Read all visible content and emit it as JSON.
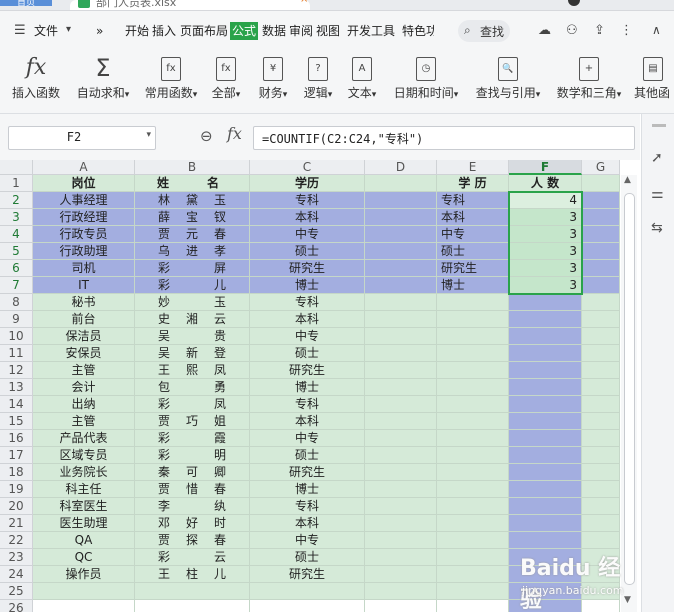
{
  "titlebar": {
    "home_tab": "首页",
    "doc_tab": "部门人员表.xlsx",
    "close": "×"
  },
  "menubar": {
    "file_menu": "文件",
    "more": "»",
    "tabs": [
      "开始",
      "插入",
      "页面布局",
      "公式",
      "数据",
      "审阅",
      "视图",
      "开发工具",
      "特色功"
    ],
    "active_tab": "公式",
    "search": "查找"
  },
  "ribbon": {
    "buttons": [
      {
        "label": "插入函数",
        "glyph": "fx"
      },
      {
        "label": "自动求和",
        "glyph": "Σ"
      },
      {
        "label": "常用函数",
        "glyph": "fx"
      },
      {
        "label": "全部",
        "glyph": "fx"
      },
      {
        "label": "财务",
        "glyph": "¥"
      },
      {
        "label": "逻辑",
        "glyph": "?"
      },
      {
        "label": "文本",
        "glyph": "A"
      },
      {
        "label": "日期和时间",
        "glyph": "◷"
      },
      {
        "label": "查找与引用",
        "glyph": "🔍"
      },
      {
        "label": "数学和三角",
        "glyph": "+"
      },
      {
        "label": "其他函",
        "glyph": "▤"
      }
    ],
    "dropdown_marker": "▾"
  },
  "formula_bar": {
    "name_box": "F2",
    "formula": "=COUNTIF(C2:C24,\"专科\")",
    "fx": "fx",
    "dropdown": "▾"
  },
  "sheet": {
    "col_headers": [
      "A",
      "B",
      "C",
      "D",
      "E",
      "F",
      "G"
    ],
    "selected_col": "F",
    "row_numbers": [
      "1",
      "2",
      "3",
      "4",
      "5",
      "6",
      "7",
      "8",
      "9",
      "10",
      "11",
      "12",
      "13",
      "14",
      "15",
      "16",
      "17",
      "18",
      "19",
      "20",
      "21",
      "22",
      "23",
      "24",
      "25",
      "26"
    ],
    "headers": {
      "a": "岗位",
      "b1": "姓",
      "b2": "名",
      "c": "学历",
      "e": "学 历",
      "f": "人 数"
    },
    "rows": [
      {
        "a": "人事经理",
        "b": [
          "林",
          "黛",
          "玉"
        ],
        "c": "专科"
      },
      {
        "a": "行政经理",
        "b": [
          "薛",
          "宝",
          "钗"
        ],
        "c": "本科"
      },
      {
        "a": "行政专员",
        "b": [
          "贾",
          "元",
          "春"
        ],
        "c": "中专"
      },
      {
        "a": "行政助理",
        "b": [
          "乌",
          "进",
          "孝"
        ],
        "c": "硕士"
      },
      {
        "a": "司机",
        "b": [
          "彩",
          "",
          "屏"
        ],
        "c": "研究生"
      },
      {
        "a": "IT",
        "b": [
          "彩",
          "",
          "儿"
        ],
        "c": "博士"
      },
      {
        "a": "秘书",
        "b": [
          "妙",
          "",
          "玉"
        ],
        "c": "专科"
      },
      {
        "a": "前台",
        "b": [
          "史",
          "湘",
          "云"
        ],
        "c": "本科"
      },
      {
        "a": "保洁员",
        "b": [
          "吴",
          "",
          "贵"
        ],
        "c": "中专"
      },
      {
        "a": "安保员",
        "b": [
          "吴",
          "新",
          "登"
        ],
        "c": "硕士"
      },
      {
        "a": "主管",
        "b": [
          "王",
          "熙",
          "凤"
        ],
        "c": "研究生"
      },
      {
        "a": "会计",
        "b": [
          "包",
          "",
          "勇"
        ],
        "c": "博士"
      },
      {
        "a": "出纳",
        "b": [
          "彩",
          "",
          "凤"
        ],
        "c": "专科"
      },
      {
        "a": "主管",
        "b": [
          "贾",
          "巧",
          "姐"
        ],
        "c": "本科"
      },
      {
        "a": "产品代表",
        "b": [
          "彩",
          "",
          "霞"
        ],
        "c": "中专"
      },
      {
        "a": "区域专员",
        "b": [
          "彩",
          "",
          "明"
        ],
        "c": "硕士"
      },
      {
        "a": "业务院长",
        "b": [
          "秦",
          "可",
          "卿"
        ],
        "c": "研究生"
      },
      {
        "a": "科主任",
        "b": [
          "贾",
          "惜",
          "春"
        ],
        "c": "博士"
      },
      {
        "a": "科室医生",
        "b": [
          "李",
          "",
          "纨"
        ],
        "c": "专科"
      },
      {
        "a": "医生助理",
        "b": [
          "邓",
          "好",
          "时"
        ],
        "c": "本科"
      },
      {
        "a": "QA",
        "b": [
          "贾",
          "探",
          "春"
        ],
        "c": "中专"
      },
      {
        "a": "QC",
        "b": [
          "彩",
          "",
          "云"
        ],
        "c": "硕士"
      },
      {
        "a": "操作员",
        "b": [
          "王",
          "柱",
          "儿"
        ],
        "c": "研究生"
      }
    ],
    "summary": [
      {
        "edu": "专科",
        "count": "4"
      },
      {
        "edu": "本科",
        "count": "3"
      },
      {
        "edu": "中专",
        "count": "3"
      },
      {
        "edu": "硕士",
        "count": "3"
      },
      {
        "edu": "研究生",
        "count": "3"
      },
      {
        "edu": "博士",
        "count": "3"
      }
    ],
    "colors": {
      "green_fill": "#d5ead8",
      "blue_fill": "#a3aee0",
      "accent": "#2aa34a"
    }
  },
  "watermark": {
    "brand": "Baidu 经验",
    "url": "jingyan.baidu.com"
  }
}
